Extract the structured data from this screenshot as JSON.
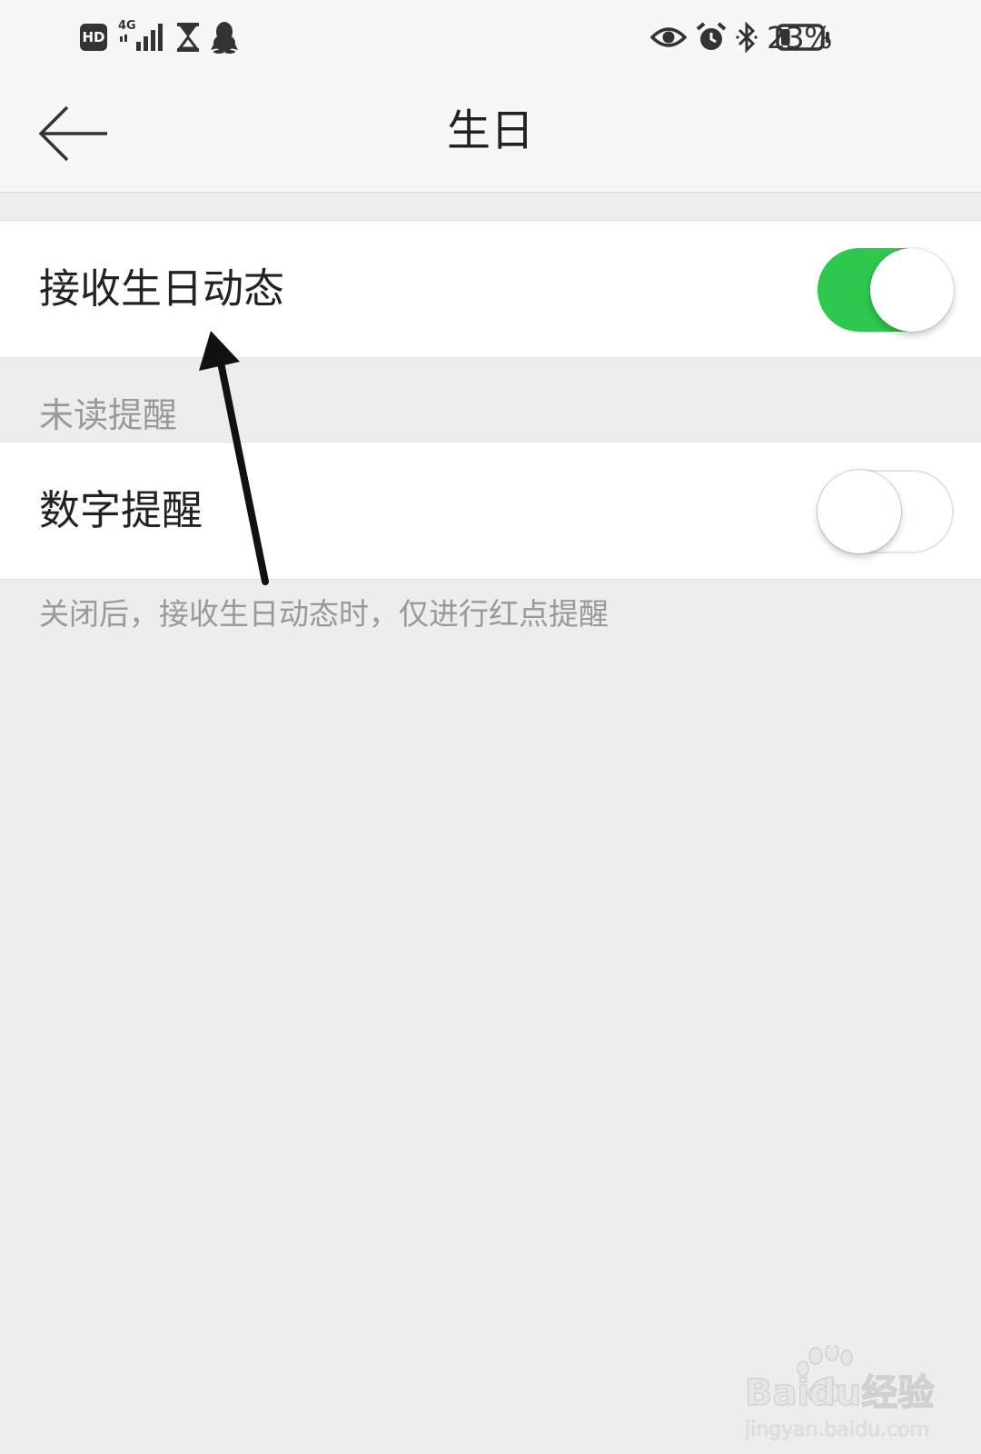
{
  "status_bar": {
    "left_icons": [
      "hd-icon",
      "signal-4g-icon",
      "hourglass-icon",
      "qq-penguin-icon"
    ],
    "hd_label": "HD",
    "network_label": "4G",
    "right_icons": [
      "eye-icon",
      "alarm-icon",
      "bluetooth-icon",
      "battery-icon"
    ],
    "battery_text": "23%",
    "battery_level": 0.23
  },
  "header": {
    "back_icon": "back-arrow-icon",
    "title": "生日"
  },
  "settings": {
    "receive_birthday": {
      "label": "接收生日动态",
      "enabled": true
    },
    "section_unread": {
      "label": "未读提醒"
    },
    "number_reminder": {
      "label": "数字提醒",
      "enabled": false
    },
    "footnote": "关闭后，接收生日动态时，仅进行红点提醒"
  },
  "colors": {
    "toggle_on": "#2dc84d",
    "background": "#ededed",
    "header_background": "#f7f7f7"
  },
  "watermark": {
    "brand": "Baidu经验",
    "url": "jingyan.baidu.com"
  }
}
